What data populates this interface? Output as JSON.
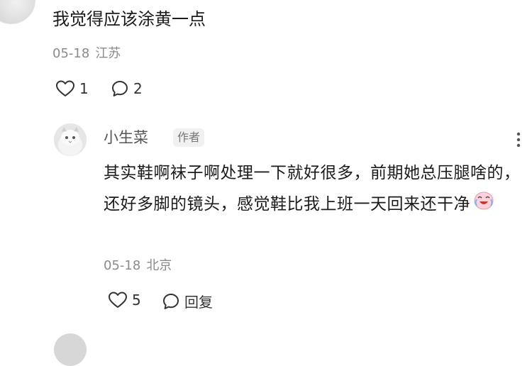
{
  "comment_top": {
    "text": "我觉得应该涂黄一点",
    "date": "05-18",
    "location": "江苏",
    "likes": "1",
    "replies": "2",
    "icons": {
      "like": "heart-icon",
      "reply": "comment-bubble-icon"
    }
  },
  "reply": {
    "username": "小生菜",
    "badge": "作者",
    "text": "其实鞋啊袜子啊处理一下就好很多，前期她总压腿啥的，还好多脚的镜头，感觉鞋比我上班一天回来还干净",
    "emoji": "crying-laugh-emoji",
    "date": "05-18",
    "location": "北京",
    "likes": "5",
    "reply_label": "回复",
    "icons": {
      "like": "heart-icon",
      "reply": "comment-bubble-icon",
      "more": "more-vertical-icon"
    }
  }
}
